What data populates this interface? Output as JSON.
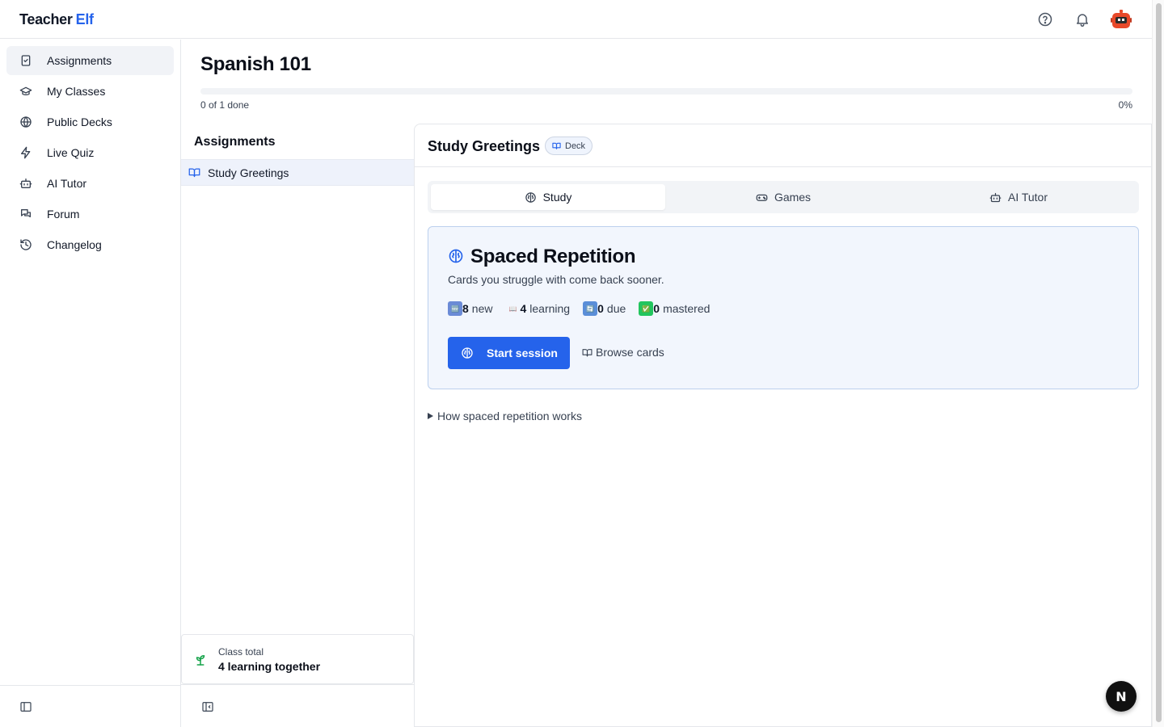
{
  "app": {
    "logo_part1": "Teacher",
    "logo_part2": "Elf",
    "brand_color": "#2563eb"
  },
  "topbar": {
    "icons": [
      "help-icon",
      "bell-icon",
      "robot-avatar"
    ]
  },
  "sidebar": {
    "items": [
      {
        "label": "Assignments",
        "icon": "clipboard-check-icon",
        "active": true
      },
      {
        "label": "My Classes",
        "icon": "graduation-cap-icon",
        "active": false
      },
      {
        "label": "Public Decks",
        "icon": "globe-icon",
        "active": false
      },
      {
        "label": "Live Quiz",
        "icon": "zap-icon",
        "active": false
      },
      {
        "label": "AI Tutor",
        "icon": "bot-icon",
        "active": false
      },
      {
        "label": "Forum",
        "icon": "messages-icon",
        "active": false
      },
      {
        "label": "Changelog",
        "icon": "history-icon",
        "active": false
      }
    ]
  },
  "page": {
    "title": "Spanish 101",
    "progress_label": "0 of 1 done",
    "progress_percent_label": "0%",
    "progress_value": 0
  },
  "assignments": {
    "heading": "Assignments",
    "items": [
      {
        "label": "Study Greetings",
        "icon": "book-open-icon",
        "selected": true
      }
    ],
    "class_total": {
      "caption": "Class total",
      "value": "4 learning together"
    }
  },
  "detail": {
    "title": "Study Greetings",
    "badge": "Deck",
    "tabs": [
      {
        "label": "Study",
        "icon": "brain-icon",
        "active": true
      },
      {
        "label": "Games",
        "icon": "gamepad-icon",
        "active": false
      },
      {
        "label": "AI Tutor",
        "icon": "bot-icon",
        "active": false
      }
    ],
    "srs": {
      "title": "Spaced Repetition",
      "subtitle": "Cards you struggle with come back sooner.",
      "stats": [
        {
          "emoji": "🆕",
          "count": "8",
          "label": "new"
        },
        {
          "emoji": "📖",
          "count": "4",
          "label": "learning"
        },
        {
          "emoji": "🔄",
          "count": "0",
          "label": "due"
        },
        {
          "emoji": "✅",
          "count": "0",
          "label": "mastered"
        }
      ],
      "start_button": "Start session",
      "browse_button": "Browse cards"
    },
    "how_it_works": "How spaced repetition works"
  },
  "fab": {
    "letter": "N"
  }
}
